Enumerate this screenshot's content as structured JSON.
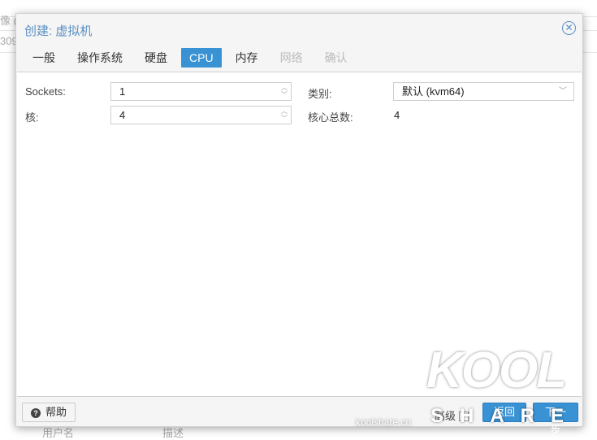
{
  "background": {
    "text1": "像 (",
    "text2": "309",
    "col1": "用户名",
    "col2": "描述"
  },
  "dialog": {
    "title": "创建: 虚拟机",
    "tabs": [
      {
        "label": "一般",
        "state": "normal"
      },
      {
        "label": "操作系统",
        "state": "normal"
      },
      {
        "label": "硬盘",
        "state": "normal"
      },
      {
        "label": "CPU",
        "state": "active"
      },
      {
        "label": "内存",
        "state": "normal"
      },
      {
        "label": "网络",
        "state": "disabled"
      },
      {
        "label": "确认",
        "state": "disabled"
      }
    ],
    "form": {
      "sockets_label": "Sockets:",
      "sockets_value": "1",
      "cores_label": "核:",
      "cores_value": "4",
      "type_label": "类别:",
      "type_value": "默认 (kvm64)",
      "total_label": "核心总数:",
      "total_value": "4"
    },
    "footer": {
      "help": "帮助",
      "advanced": "高级",
      "back": "返回",
      "next": "下一步"
    }
  },
  "watermark": {
    "logo": "KOOL SHARE",
    "site": "koolshare.cn"
  },
  "colors": {
    "accent": "#3892d4",
    "title": "#5b8fc4"
  }
}
